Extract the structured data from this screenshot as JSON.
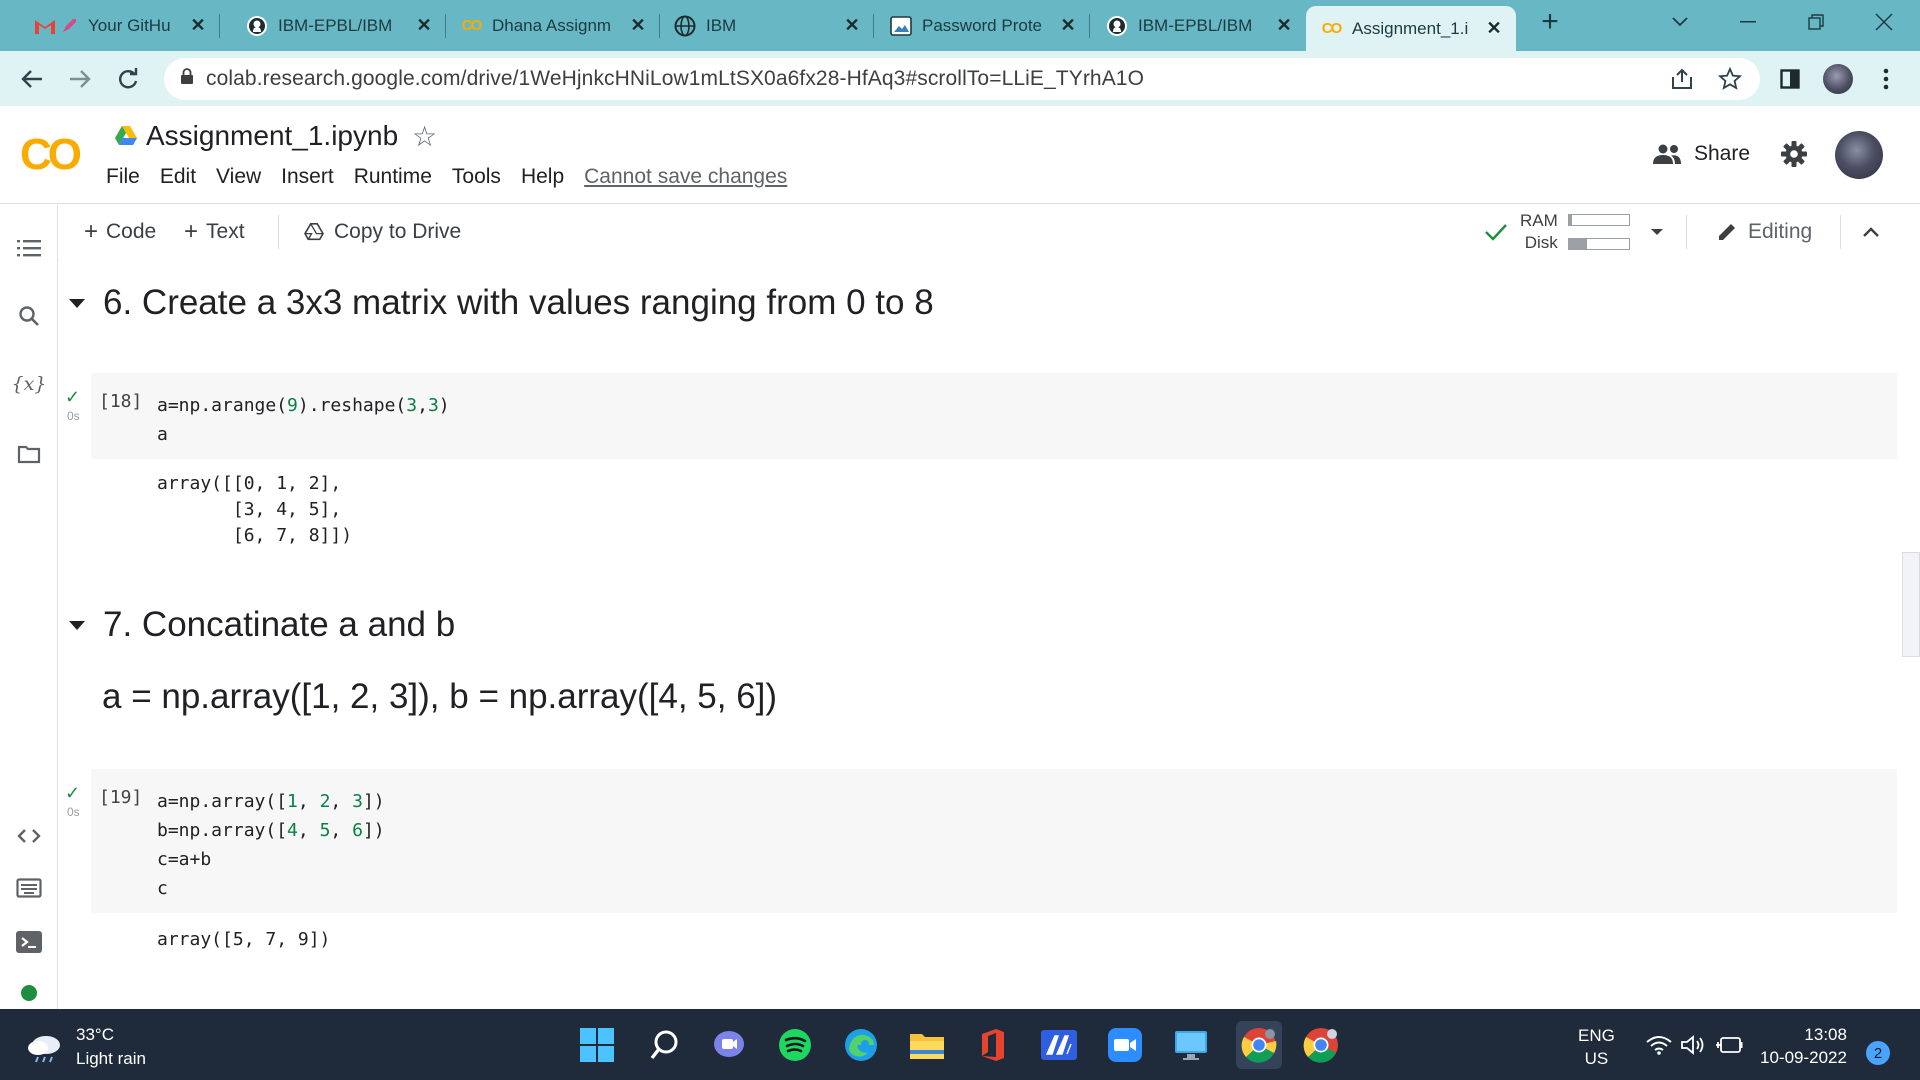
{
  "browser": {
    "tabs": [
      {
        "title": "Your GitHu",
        "favicon": "gmail-rocket-icon",
        "active": false
      },
      {
        "title": "IBM-EPBL/IBM",
        "favicon": "github-icon",
        "active": false
      },
      {
        "title": "Dhana Assignm",
        "favicon": "colab-icon",
        "active": false
      },
      {
        "title": "IBM",
        "favicon": "globe-icon",
        "active": false
      },
      {
        "title": "Password Prote",
        "favicon": "image-icon",
        "active": false
      },
      {
        "title": "IBM-EPBL/IBM",
        "favicon": "github-icon",
        "active": false
      },
      {
        "title": "Assignment_1.i",
        "favicon": "colab-icon",
        "active": true
      }
    ],
    "url": "colab.research.google.com/drive/1WeHjnkcHNiLow1mLtSX0a6fx28-HfAq3#scrollTo=LLiE_TYrhA1O"
  },
  "colab": {
    "notebook_title": "Assignment_1.ipynb",
    "menu": [
      "File",
      "Edit",
      "View",
      "Insert",
      "Runtime",
      "Tools",
      "Help"
    ],
    "cannot_save": "Cannot save changes",
    "share_label": "Share",
    "toolbar": {
      "code_label": "Code",
      "text_label": "Text",
      "copy_label": "Copy to Drive",
      "ram_label": "RAM",
      "disk_label": "Disk",
      "editing_label": "Editing",
      "ram_usage": 0.05,
      "disk_usage": 0.3
    },
    "sections": [
      {
        "heading": "6. Create a 3x3 matrix with values ranging from 0 to 8",
        "cell": {
          "prompt": "[18]",
          "time": "0s",
          "code_lines": [
            "a=np.arange(9).reshape(3,3)",
            "a"
          ],
          "output": "array([[0, 1, 2],\n       [3, 4, 5],\n       [6, 7, 8]])"
        }
      },
      {
        "heading": "7. Concatinate a and b",
        "subtext": "a = np.array([1, 2, 3]), b = np.array([4, 5, 6])",
        "cell": {
          "prompt": "[19]",
          "time": "0s",
          "code_lines": [
            "a=np.array([1, 2, 3])",
            "b=np.array([4, 5, 6])",
            "c=a+b",
            "c"
          ],
          "output": "array([5, 7, 9])"
        }
      }
    ]
  },
  "taskbar": {
    "temperature": "33°C",
    "weather": "Light rain",
    "lang": "ENG",
    "region": "US",
    "time": "13:08",
    "date": "10-09-2022",
    "notifications": "2"
  },
  "colors": {
    "tab_strip": "#67b8c4",
    "toolbar_bg": "#dff3f5",
    "colab_orange": "#f9ab00",
    "success_green": "#1e8e3e",
    "taskbar_bg": "#1f2a3a"
  }
}
